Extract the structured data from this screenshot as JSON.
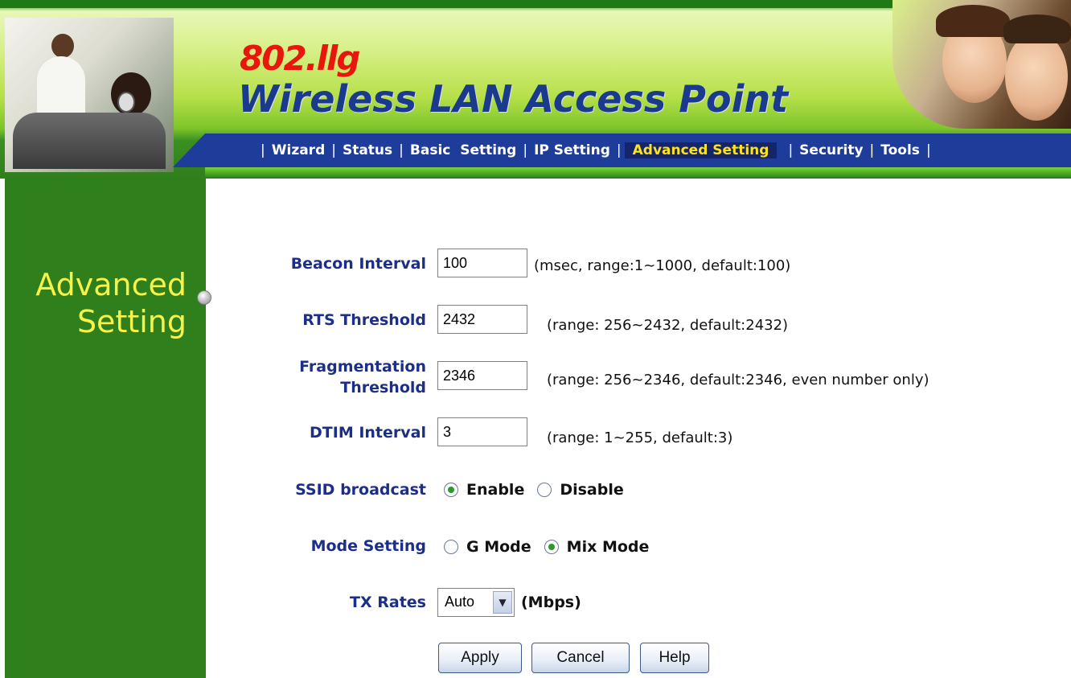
{
  "header": {
    "brand_model": "802.llg",
    "brand_title": "Wireless LAN Access Point"
  },
  "nav": {
    "items": [
      {
        "label": "Wizard",
        "active": false
      },
      {
        "label": "Status",
        "active": false
      },
      {
        "label": "Basic  Setting",
        "active": false
      },
      {
        "label": "IP Setting",
        "active": false
      },
      {
        "label": "Advanced Setting",
        "active": true
      },
      {
        "label": "Security",
        "active": false
      },
      {
        "label": "Tools",
        "active": false
      }
    ],
    "separator": "|"
  },
  "sidebar": {
    "title_line1": "Advanced",
    "title_line2": "Setting"
  },
  "form": {
    "beacon": {
      "label": "Beacon Interval",
      "value": "100",
      "hint": "(msec, range:1~1000, default:100)"
    },
    "rts": {
      "label": "RTS Threshold",
      "value": "2432",
      "hint": "(range: 256~2432, default:2432)"
    },
    "frag": {
      "label_line1": "Fragmentation",
      "label_line2": "Threshold",
      "value": "2346",
      "hint": "(range: 256~2346, default:2346, even number only)"
    },
    "dtim": {
      "label": "DTIM Interval",
      "value": "3",
      "hint": "(range: 1~255, default:3)"
    },
    "ssid": {
      "label": "SSID broadcast",
      "option1": "Enable",
      "option2": "Disable",
      "selected": "Enable"
    },
    "mode": {
      "label": "Mode Setting",
      "option1": "G Mode",
      "option2": "Mix Mode",
      "selected": "Mix Mode"
    },
    "tx": {
      "label": "TX Rates",
      "value": "Auto",
      "unit": "(Mbps)"
    }
  },
  "buttons": {
    "apply": "Apply",
    "cancel": "Cancel",
    "help": "Help"
  },
  "colors": {
    "sidebar_green": "#2f7f1c",
    "nav_blue": "#1e3d9a",
    "active_nav_text": "#ffe31a",
    "label_blue": "#1c2f88",
    "sidebar_text": "#f6f24a",
    "brand_red": "#e8160c"
  }
}
